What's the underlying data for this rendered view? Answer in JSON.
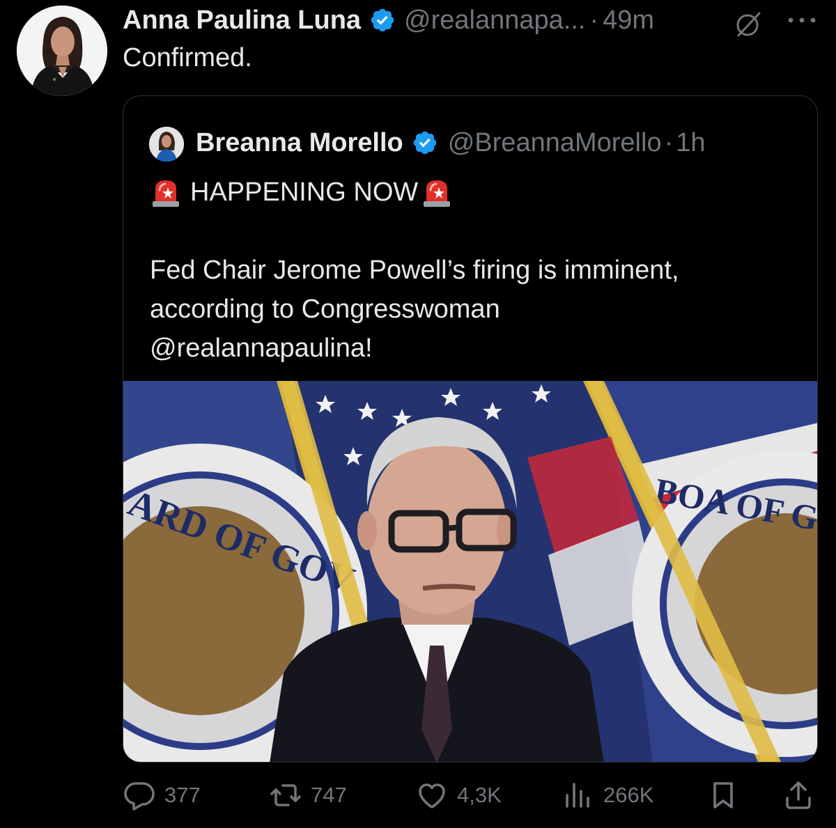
{
  "tweet": {
    "author": {
      "display_name": "Anna Paulina Luna",
      "handle": "@realannapa...",
      "verified": true
    },
    "separator": "·",
    "time": "49m",
    "text": "Confirmed."
  },
  "quote": {
    "author": {
      "display_name": "Breanna Morello",
      "handle": "@BreannaMorello",
      "verified": true
    },
    "separator": "·",
    "time": "1h",
    "headline": "HAPPENING NOW",
    "body_lines": [
      "Fed Chair Jerome Powell’s firing is imminent,",
      "according to Congresswoman",
      "@realannapaulina!"
    ],
    "image": {
      "seal_text_left": "ARD OF GOV",
      "seal_text_right": "BOA OF GOVER"
    }
  },
  "actions": {
    "replies": "377",
    "reposts": "747",
    "likes": "4,3K",
    "views": "266K"
  },
  "colors": {
    "background": "#000000",
    "primary_text": "#e7e9ea",
    "secondary_text": "#71767b",
    "verified_blue": "#1d9bf0",
    "border": "#2f3336"
  }
}
